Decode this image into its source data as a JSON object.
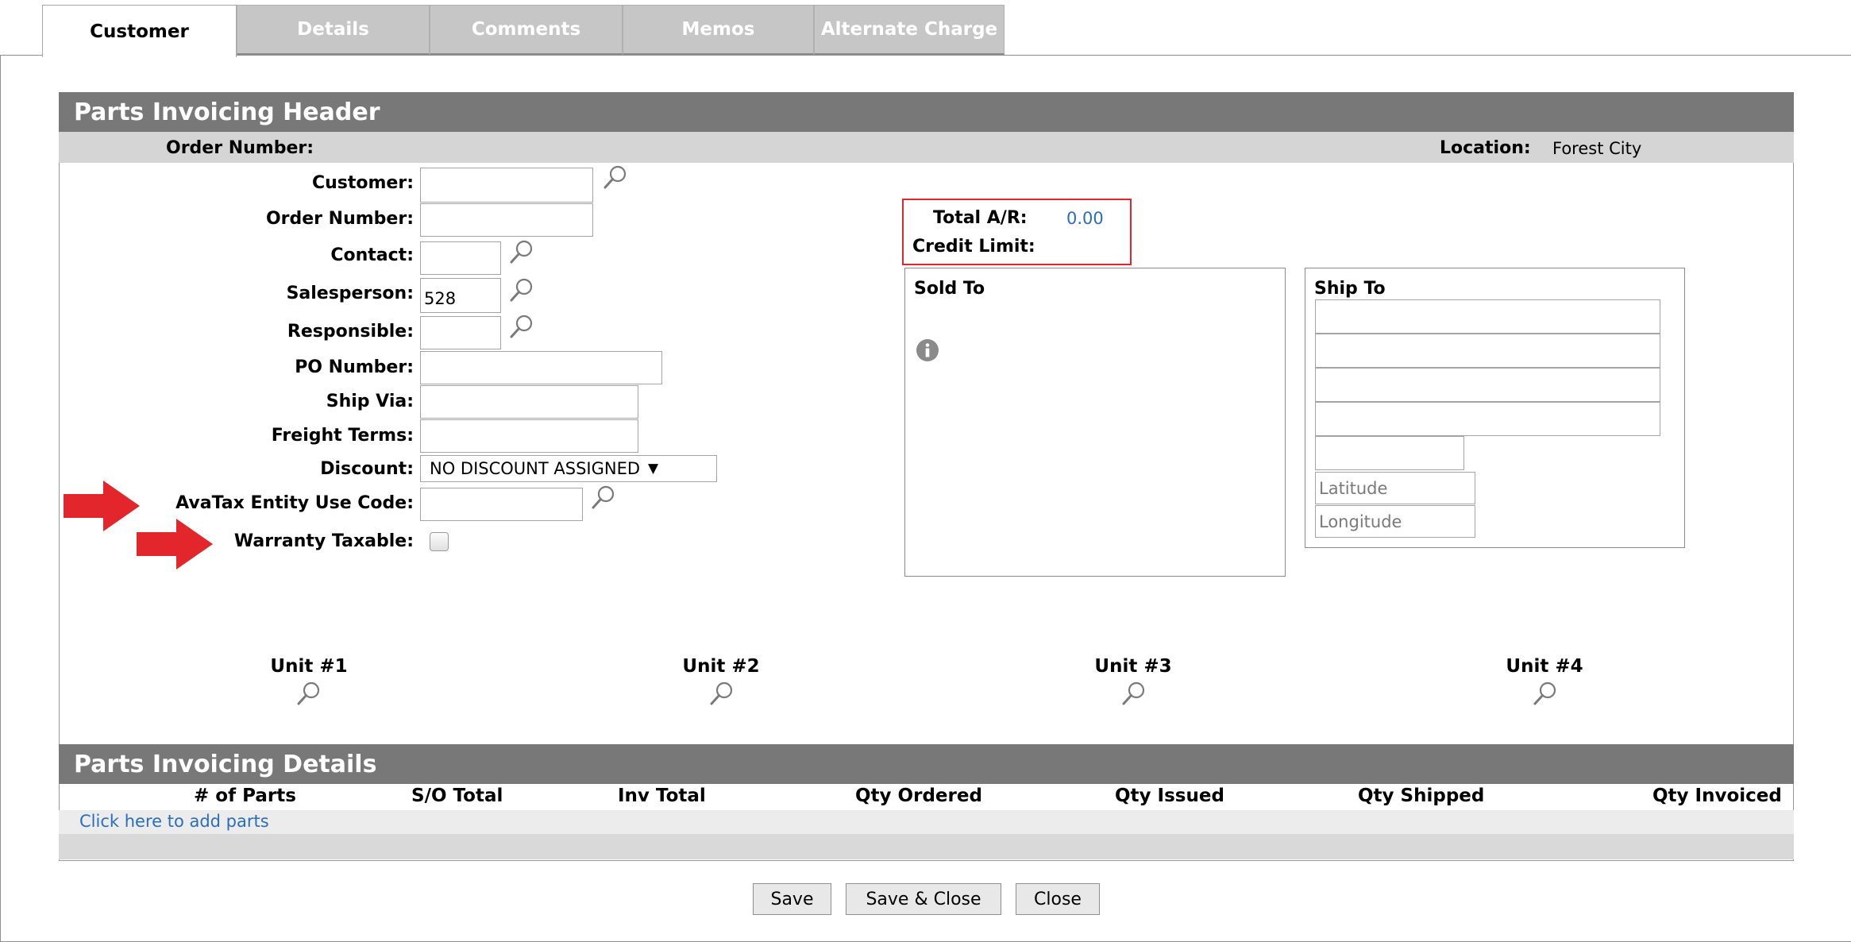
{
  "tabs": [
    {
      "label": "Customer",
      "active": true
    },
    {
      "label": "Details",
      "active": false
    },
    {
      "label": "Comments",
      "active": false
    },
    {
      "label": "Memos",
      "active": false
    },
    {
      "label": "Alternate Charge",
      "active": false
    }
  ],
  "header": {
    "title": "Parts Invoicing Header",
    "order_number_label": "Order Number:",
    "location_label": "Location:",
    "location_value": "Forest City"
  },
  "form": {
    "customer_label": "Customer:",
    "customer_value": "",
    "order_number_label": "Order Number:",
    "order_number_value": "",
    "contact_label": "Contact:",
    "contact_value": "",
    "salesperson_label": "Salesperson:",
    "salesperson_value": "528",
    "responsible_label": "Responsible:",
    "responsible_value": "",
    "po_number_label": "PO Number:",
    "po_number_value": "",
    "ship_via_label": "Ship Via:",
    "ship_via_value": "",
    "freight_terms_label": "Freight Terms:",
    "freight_terms_value": "",
    "discount_label": "Discount:",
    "discount_value": "NO DISCOUNT ASSIGNED",
    "avatax_label": "AvaTax Entity Use Code:",
    "avatax_value": "",
    "warranty_taxable_label": "Warranty Taxable:",
    "warranty_taxable_checked": false
  },
  "credit": {
    "total_ar_label": "Total A/R:",
    "total_ar_value": "0.00",
    "credit_limit_label": "Credit Limit:",
    "credit_limit_value": ""
  },
  "sold_to": {
    "title": "Sold To"
  },
  "ship_to": {
    "title": "Ship To",
    "latitude_placeholder": "Latitude",
    "longitude_placeholder": "Longitude"
  },
  "units": [
    "Unit #1",
    "Unit #2",
    "Unit #3",
    "Unit #4"
  ],
  "details": {
    "title": "Parts Invoicing Details",
    "columns": [
      "# of Parts",
      "S/O Total",
      "Inv Total",
      "Qty Ordered",
      "Qty Issued",
      "Qty Shipped",
      "Qty Invoiced"
    ],
    "add_parts_link": "Click here to add parts"
  },
  "buttons": {
    "save": "Save",
    "save_close": "Save & Close",
    "close": "Close"
  },
  "colors": {
    "section_bar": "#787878",
    "subbar": "#d5d5d5",
    "link": "#2a6ebb",
    "annotation_red": "#e3262b",
    "tab_inactive": "#c6c6c6"
  },
  "icons": {
    "lookup": "magnifier-icon",
    "info": "info-circle-icon",
    "annotation": "red-arrow-icon",
    "dropdown": "triangle-down-icon"
  }
}
